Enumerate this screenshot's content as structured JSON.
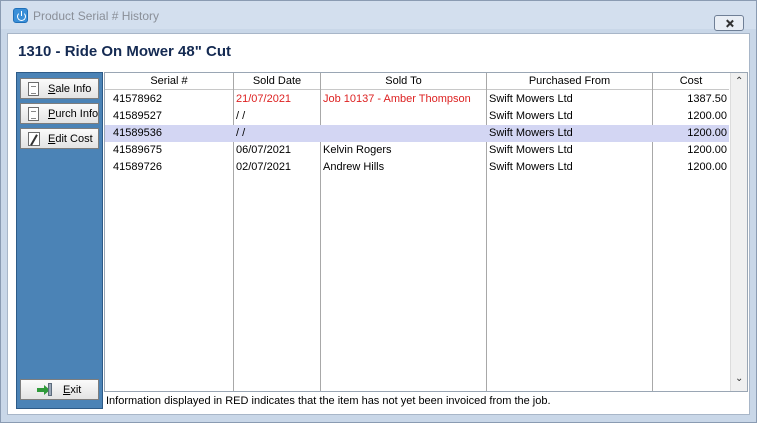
{
  "window": {
    "title": "Product Serial # History"
  },
  "product": {
    "title": "1310 - Ride On Mower 48\" Cut"
  },
  "sidebar": {
    "buttons": [
      {
        "pre": "",
        "ul": "S",
        "post": "ale Info",
        "icon": "document-icon"
      },
      {
        "pre": "",
        "ul": "P",
        "post": "urch Info",
        "icon": "document-icon"
      },
      {
        "pre": "",
        "ul": "E",
        "post": "dit Cost",
        "icon": "pencil-icon"
      }
    ],
    "exit": {
      "pre": "",
      "ul": "E",
      "post": "xit",
      "icon": "exit-icon"
    }
  },
  "table": {
    "columns": [
      "Serial #",
      "Sold Date",
      "Sold To",
      "Purchased From",
      "Cost"
    ],
    "rows": [
      {
        "serial": "41578962",
        "sold_date": "21/07/2021",
        "sold_to": "Job 10137 - Amber Thompson",
        "purchased_from": "Swift Mowers Ltd",
        "cost": "1387.50",
        "highlight": "red",
        "selected": false
      },
      {
        "serial": "41589527",
        "sold_date": "/ /",
        "sold_to": "",
        "purchased_from": "Swift Mowers Ltd",
        "cost": "1200.00",
        "highlight": "",
        "selected": false
      },
      {
        "serial": "41589536",
        "sold_date": "/ /",
        "sold_to": "",
        "purchased_from": "Swift Mowers Ltd",
        "cost": "1200.00",
        "highlight": "",
        "selected": true
      },
      {
        "serial": "41589675",
        "sold_date": "06/07/2021",
        "sold_to": "Kelvin Rogers",
        "purchased_from": "Swift Mowers Ltd",
        "cost": "1200.00",
        "highlight": "",
        "selected": false
      },
      {
        "serial": "41589726",
        "sold_date": "02/07/2021",
        "sold_to": "Andrew Hills",
        "purchased_from": "Swift Mowers Ltd",
        "cost": "1200.00",
        "highlight": "",
        "selected": false
      }
    ]
  },
  "footer": {
    "note": "Information displayed in RED indicates that the item has not yet been invoiced from the job."
  },
  "colors": {
    "sidebar": "#4b83b6",
    "selected_row": "#d3d6f3",
    "uninvoiced_text": "#dd2222",
    "title_text": "#142a52"
  }
}
